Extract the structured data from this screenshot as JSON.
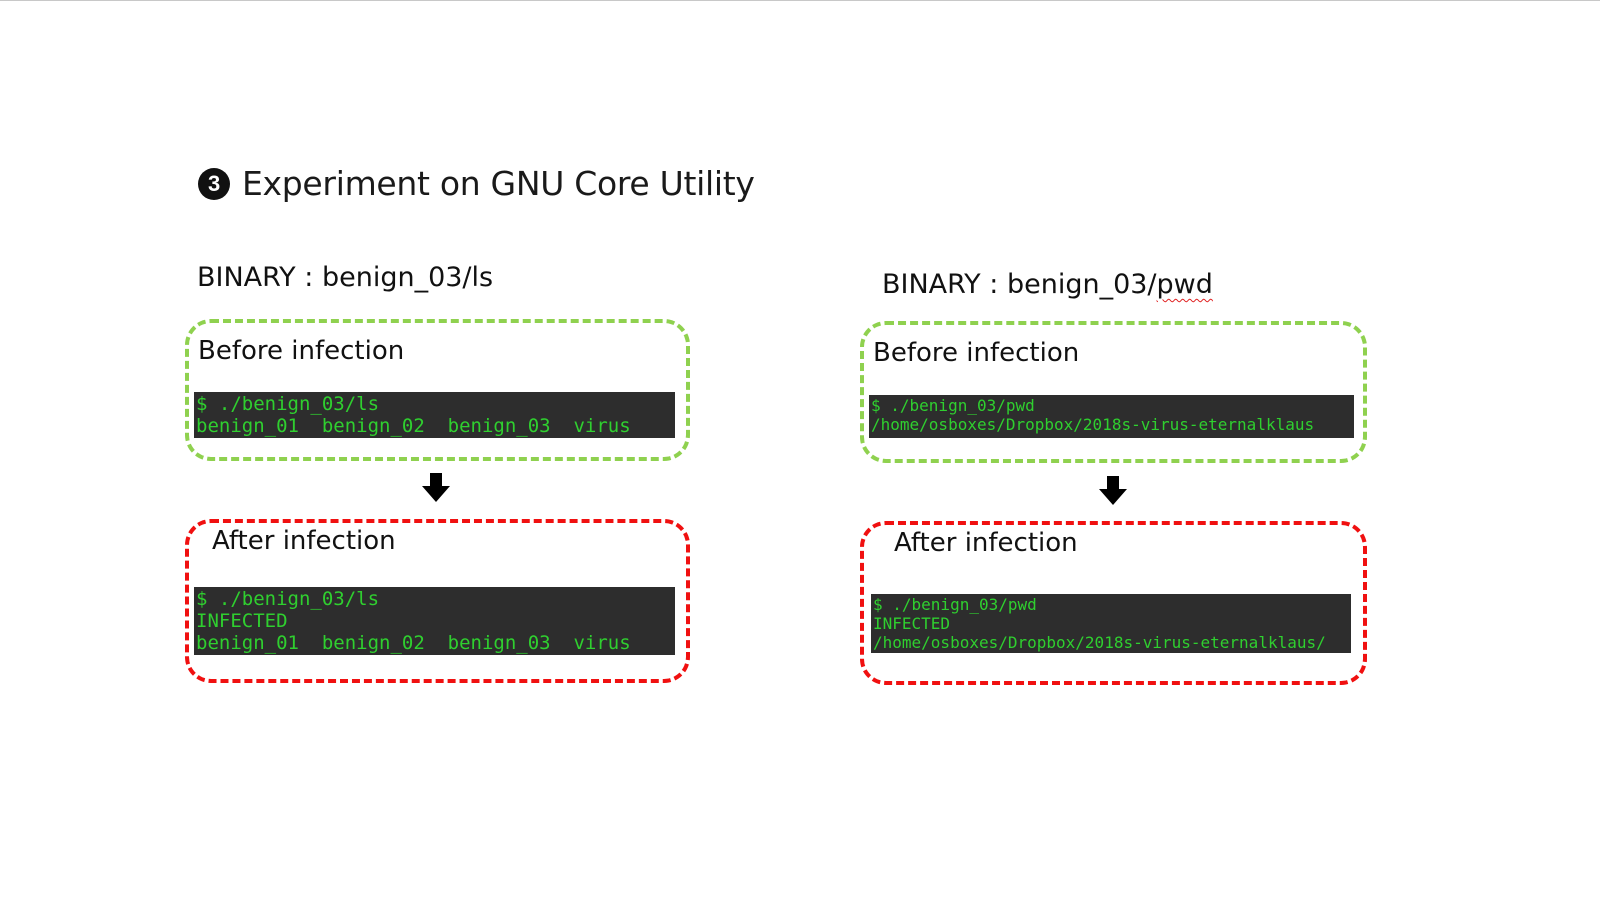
{
  "title": {
    "number": "3",
    "text": "Experiment on GNU Core Utility"
  },
  "panels": [
    {
      "binary_label": "BINARY : ",
      "binary_path_main": "benign_03/",
      "binary_path_tail": "ls",
      "before_label": "Before infection",
      "before_lines": [
        "$ ./benign_03/ls",
        "benign_01  benign_02  benign_03  virus"
      ],
      "after_label": "After infection",
      "after_lines": [
        "$ ./benign_03/ls",
        "INFECTED",
        "benign_01  benign_02  benign_03  virus"
      ]
    },
    {
      "binary_label": "BINARY : ",
      "binary_path_main": "benign_03/",
      "binary_path_tail": "pwd",
      "before_label": "Before infection",
      "before_lines": [
        "$ ./benign_03/pwd",
        "/home/osboxes/Dropbox/2018s-virus-eternalklaus"
      ],
      "after_label": "After infection",
      "after_lines": [
        "$ ./benign_03/pwd",
        "INFECTED",
        "/home/osboxes/Dropbox/2018s-virus-eternalklaus/"
      ]
    }
  ],
  "icons": {
    "arrow": "arrow-down-icon",
    "number_badge": "number-3-badge-icon"
  },
  "colors": {
    "before_border": "#8fd14f",
    "after_border": "#f01010",
    "terminal_bg": "#2d2d2d",
    "terminal_text": "#2fcf2f"
  }
}
